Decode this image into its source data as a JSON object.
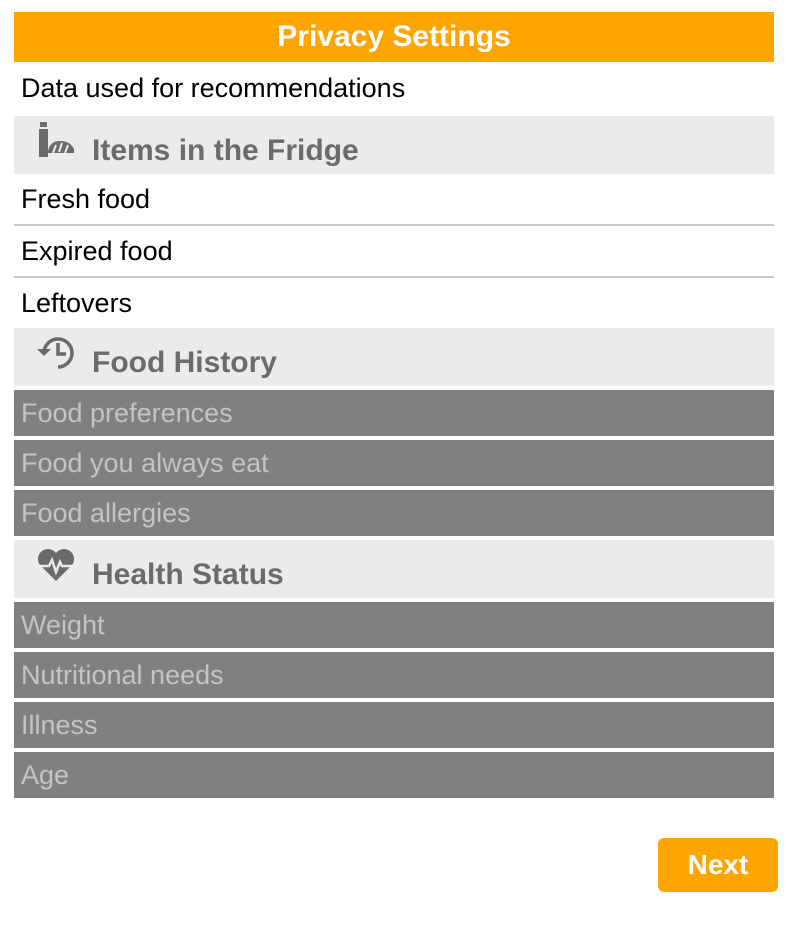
{
  "title": "Privacy Settings",
  "intro": "Data used for recommendations",
  "sections": {
    "fridge": {
      "label": "Items in the Fridge",
      "icon": "bottle-bread-icon",
      "items": [
        "Fresh food",
        "Expired food",
        "Leftovers"
      ]
    },
    "history": {
      "label": "Food History",
      "icon": "history-icon",
      "items": [
        "Food preferences",
        "Food you always eat",
        "Food allergies"
      ]
    },
    "health": {
      "label": "Health Status",
      "icon": "heart-pulse-icon",
      "items": [
        "Weight",
        "Nutritional needs",
        "Illness",
        "Age"
      ]
    }
  },
  "next_label": "Next",
  "colors": {
    "accent": "#ffa500",
    "header_bg": "#ebebeb",
    "disabled_bg": "#808080",
    "disabled_text": "#c4c4c4"
  }
}
